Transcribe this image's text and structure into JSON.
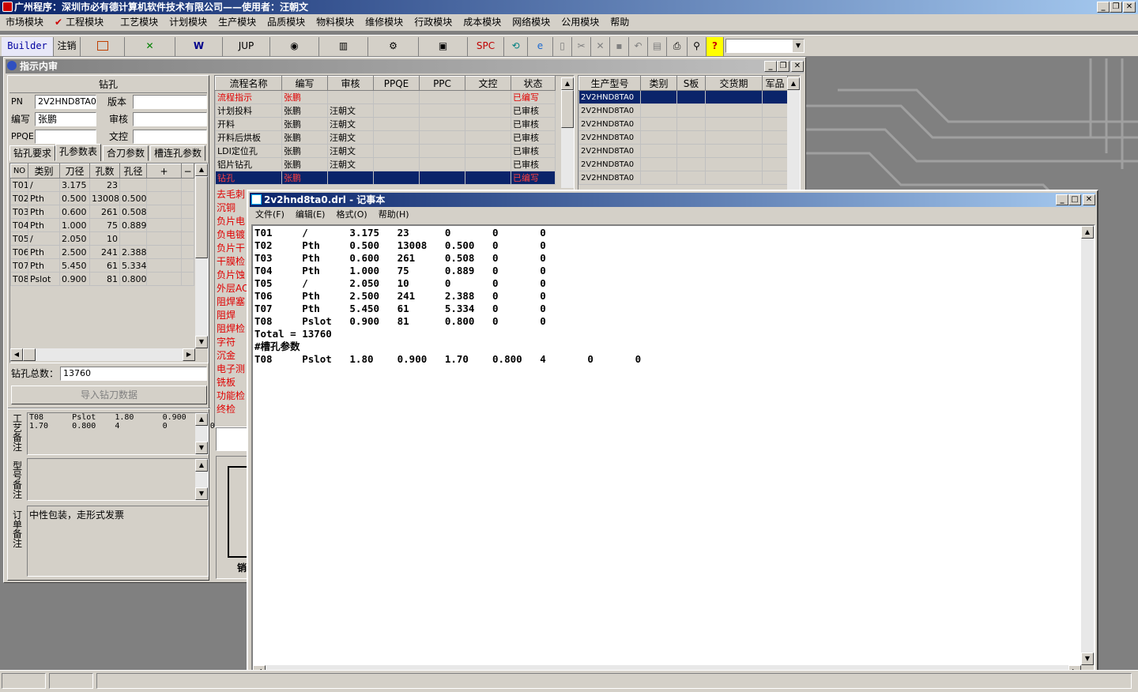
{
  "app": {
    "title": "广州程序：深圳市必有德计算机软件技术有限公司——使用者：汪朝文",
    "menus": [
      "市场模块",
      "工程模块",
      "工艺模块",
      "计划模块",
      "生产模块",
      "品质模块",
      "物料模块",
      "维修模块",
      "行政模块",
      "成本模块",
      "网络模块",
      "公用模块",
      "帮助"
    ]
  },
  "toolbar": {
    "builder": "Builder",
    "logout": "注销",
    "jup": "JUP",
    "spc": "SPC"
  },
  "inner_window": {
    "title": "指示内审"
  },
  "panel": {
    "header": "钻孔",
    "pn_label": "PN",
    "pn_value": "2V2HND8TA0",
    "version_label": "版本",
    "author_label": "编写",
    "author_value": "张鹏",
    "review_label": "审核",
    "ppqe_label": "PPQE",
    "doc_label": "文控",
    "tabs": [
      "钻孔要求",
      "孔参数表",
      "合刀参数",
      "槽连孔参数"
    ],
    "drill_headers": [
      "NO",
      "类别",
      "刀径",
      "孔数",
      "孔径",
      "+",
      "−"
    ],
    "drill_rows": [
      [
        "T01",
        "/",
        "3.175",
        "23",
        ""
      ],
      [
        "T02",
        "Pth",
        "0.500",
        "13008",
        "0.500"
      ],
      [
        "T03",
        "Pth",
        "0.600",
        "261",
        "0.508"
      ],
      [
        "T04",
        "Pth",
        "1.000",
        "75",
        "0.889"
      ],
      [
        "T05",
        "/",
        "2.050",
        "10",
        ""
      ],
      [
        "T06",
        "Pth",
        "2.500",
        "241",
        "2.388"
      ],
      [
        "T07",
        "Pth",
        "5.450",
        "61",
        "5.334"
      ],
      [
        "T08",
        "Pslot",
        "0.900",
        "81",
        "0.800"
      ]
    ],
    "total_label": "钻孔总数：",
    "total_value": "13760",
    "import_btn": "导入钻刀数据",
    "craft_label": "工艺备注",
    "craft_lines": [
      "T08      Pslot    1.80      0.900",
      "1.70     0.800    4         0         0"
    ],
    "model_label": "型号备注",
    "order_label": "订单备注",
    "order_text": "中性包装，走形式发票"
  },
  "process": {
    "headers": [
      "流程名称",
      "编写",
      "审核",
      "PPQE",
      "PPC",
      "文控",
      "状态"
    ],
    "rows": [
      [
        "流程指示",
        "张鹏",
        "",
        "",
        "",
        "",
        "已编写"
      ],
      [
        "计划投料",
        "张鹏",
        "汪朝文",
        "",
        "",
        "",
        "已审核"
      ],
      [
        "开料",
        "张鹏",
        "汪朝文",
        "",
        "",
        "",
        "已审核"
      ],
      [
        "开料后烘板",
        "张鹏",
        "汪朝文",
        "",
        "",
        "",
        "已审核"
      ],
      [
        "LDI定位孔",
        "张鹏",
        "汪朝文",
        "",
        "",
        "",
        "已审核"
      ],
      [
        "铝片钻孔",
        "张鹏",
        "汪朝文",
        "",
        "",
        "",
        "已审核"
      ],
      [
        "钻孔",
        "张鹏",
        "",
        "",
        "",
        "",
        "已编写"
      ]
    ],
    "left_items": [
      "去毛刺",
      "沉铜",
      "负片电",
      "负电镀",
      "负片干",
      "干膜检",
      "负片蚀",
      "外层AO",
      "阻焊塞",
      "阻焊",
      "阻焊检",
      "字符",
      "沉金",
      "电子测",
      "铣板",
      "功能检",
      "终检"
    ],
    "bottom_label": "销"
  },
  "models": {
    "headers": [
      "生产型号",
      "类别",
      "S板",
      "交货期",
      "军品"
    ],
    "rows": [
      "2V2HND8TA0",
      "2V2HND8TA0",
      "2V2HND8TA0",
      "2V2HND8TA0",
      "2V2HND8TA0",
      "2V2HND8TA0",
      "2V2HND8TA0"
    ]
  },
  "notepad": {
    "title": "2v2hnd8ta0.drl - 记事本",
    "menus": [
      "文件(F)",
      "编辑(E)",
      "格式(O)",
      "帮助(H)"
    ],
    "lines": [
      "T01     /       3.175   23      0       0       0",
      "T02     Pth     0.500   13008   0.500   0       0",
      "T03     Pth     0.600   261     0.508   0       0",
      "T04     Pth     1.000   75      0.889   0       0",
      "T05     /       2.050   10      0       0       0",
      "T06     Pth     2.500   241     2.388   0       0",
      "T07     Pth     5.450   61      5.334   0       0",
      "T08     Pslot   0.900   81      0.800   0       0",
      "Total = 13760",
      "#槽孔参数",
      "T08     Pslot   1.80    0.900   1.70    0.800   4       0       0"
    ]
  }
}
